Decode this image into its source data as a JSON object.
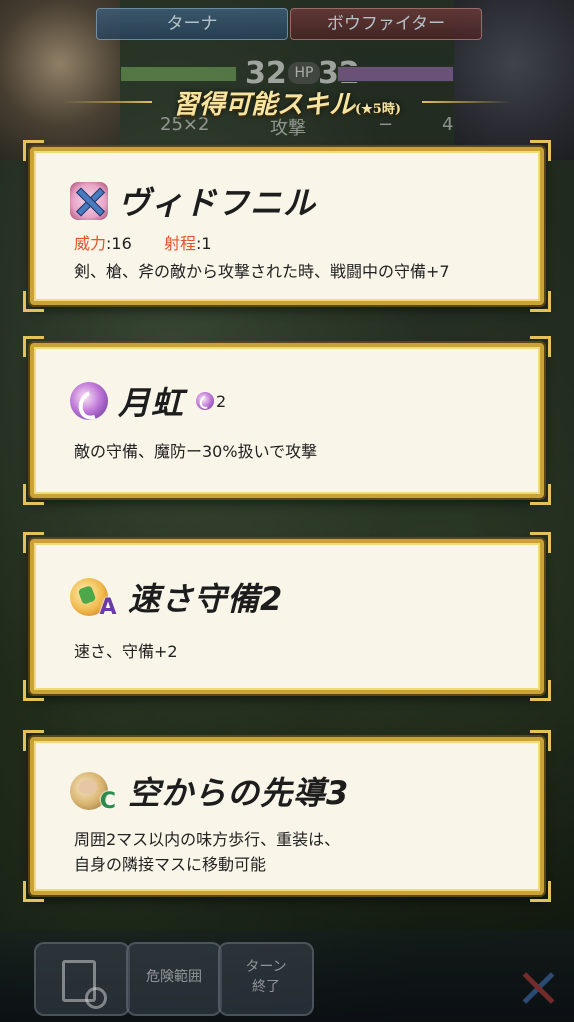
{
  "hud": {
    "left_name": "ターナ",
    "right_name": "ボウファイター",
    "hp_left": "32",
    "hp_label": "HP",
    "hp_right": "32",
    "damage": "25×2",
    "action": "攻撃",
    "right_damage": "−",
    "right_count": "4"
  },
  "header": {
    "title": "習得可能スキル",
    "subtitle": "(★5時)"
  },
  "skills": [
    {
      "name": "ヴィドフニル",
      "icon": "weapon-icon",
      "might_label": "威力",
      "might_value": ":16",
      "range_label": "射程",
      "range_value": ":1",
      "desc": "剣、槍、斧の敵から攻撃された時、戦闘中の守備+7"
    },
    {
      "name": "月虹",
      "icon": "special-icon",
      "cooldown": "2",
      "desc": "敵の守備、魔防ー30%扱いで攻撃"
    },
    {
      "name": "速さ守備2",
      "icon": "passive-a-icon",
      "badge": "A",
      "desc": "速さ、守備+2"
    },
    {
      "name": "空からの先導3",
      "icon": "passive-c-icon",
      "badge": "C",
      "desc_line1": "周囲2マス以内の味方歩行、重装は、",
      "desc_line2": "自身の隣接マスに移動可能"
    }
  ],
  "toolbar": {
    "danger_label": "危険範囲",
    "end_line1": "ターン",
    "end_line2": "終了"
  },
  "colors": {
    "card_border": "#c9a336",
    "card_bg": "#f9f5e8",
    "stat_label": "#e0552b"
  }
}
